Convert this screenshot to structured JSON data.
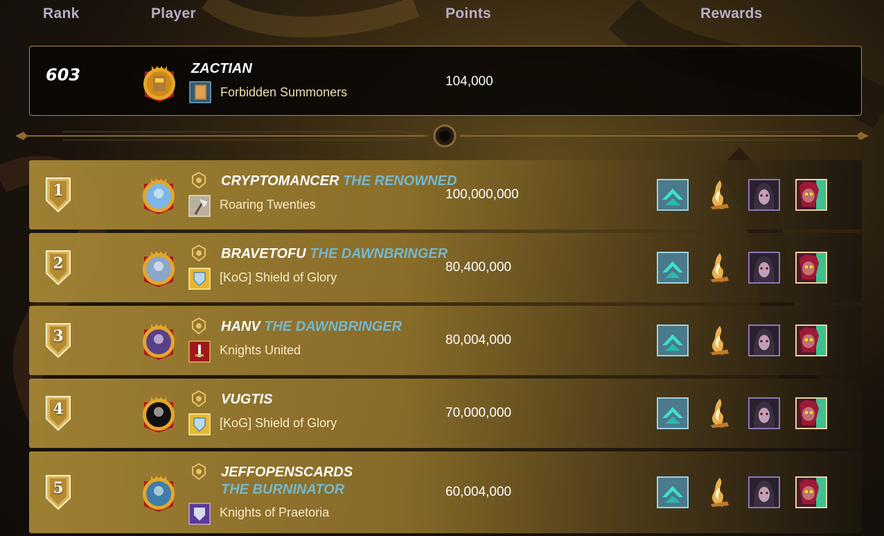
{
  "header": {
    "rank": "Rank",
    "player": "Player",
    "points": "Points",
    "rewards": "Rewards"
  },
  "self": {
    "rank": "603",
    "name": "ZACTIAN",
    "guild": "Forbidden Summoners",
    "points": "104,000"
  },
  "rows": [
    {
      "rank": "1",
      "name": "CRYPTOMANCER",
      "title": " THE RENOWNED",
      "guild": "Roaring Twenties",
      "points": "100,000,000",
      "avatar_color": "#7db7e8",
      "guild_icon": "axe-icon",
      "title_icon": "helm-icon"
    },
    {
      "rank": "2",
      "name": "BRAVETOFU",
      "title": " THE DAWNBRINGER",
      "guild": "[KoG] Shield of Glory",
      "points": "80,400,000",
      "avatar_color": "#8aa6c8",
      "guild_icon": "shield-icon",
      "title_icon": "sun-icon"
    },
    {
      "rank": "3",
      "name": "HANV",
      "title": " THE DAWNBRINGER",
      "guild": "Knights United",
      "points": "80,004,000",
      "avatar_color": "#5a3f8a",
      "guild_icon": "sword-icon",
      "title_icon": "sun-icon"
    },
    {
      "rank": "4",
      "name": "VUGTIS",
      "title": "",
      "guild": "[KoG] Shield of Glory",
      "points": "70,000,000",
      "avatar_color": "#111111",
      "guild_icon": "shield-icon",
      "title_icon": "crown-icon"
    },
    {
      "rank": "5",
      "name": "JEFFOPENSCARDS",
      "title": " THE BURNINATOR",
      "guild": "Knights of Praetoria",
      "points": "60,004,000",
      "avatar_color": "#3f7ea8",
      "guild_icon": "purple-shield-icon",
      "title_icon": "flame-icon"
    }
  ],
  "rewards": [
    "chevron-card-icon",
    "flame-icon",
    "hooded-villain-card-icon",
    "red-demon-card-icon"
  ],
  "colors": {
    "title_accent": "#74b8cf",
    "row_gold": "#a88836",
    "self_border": "#b08a3a"
  }
}
